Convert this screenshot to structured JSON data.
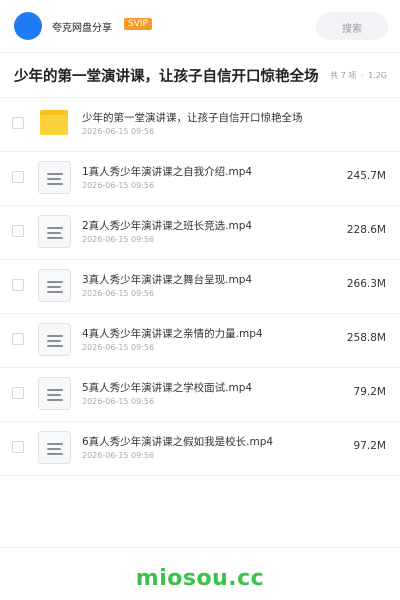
{
  "header": {
    "app_name": "夸克网盘分享",
    "badge": "SVIP",
    "search_placeholder": "搜索",
    "avatar_color": "#1f7cf5"
  },
  "share": {
    "title": "少年的第一堂演讲课，让孩子自信开口惊艳全场",
    "count": "共 7 项",
    "separator": "·",
    "total_size": "1.2G"
  },
  "files": [
    {
      "name": "少年的第一堂演讲课，让孩子自信开口惊艳全场",
      "date": "2026-06-15 09:56",
      "size": "",
      "icon": "folder-icon"
    },
    {
      "name": "1真人秀少年演讲课之自我介绍.mp4",
      "date": "2026-06-15 09:56",
      "size": "245.7M",
      "icon": "video-file-icon"
    },
    {
      "name": "2真人秀少年演讲课之班长竞选.mp4",
      "date": "2026-06-15 09:56",
      "size": "228.6M",
      "icon": "video-file-icon"
    },
    {
      "name": "3真人秀少年演讲课之舞台呈现.mp4",
      "date": "2026-06-15 09:56",
      "size": "266.3M",
      "icon": "video-file-icon"
    },
    {
      "name": "4真人秀少年演讲课之亲情的力量.mp4",
      "date": "2026-06-15 09:56",
      "size": "258.8M",
      "icon": "video-file-icon"
    },
    {
      "name": "5真人秀少年演讲课之学校面试.mp4",
      "date": "2026-06-15 09:56",
      "size": "79.2M",
      "icon": "video-file-icon"
    },
    {
      "name": "6真人秀少年演讲课之假如我是校长.mp4",
      "date": "2026-06-15 09:56",
      "size": "97.2M",
      "icon": "video-file-icon"
    }
  ],
  "watermark": "miosou.cc",
  "colors": {
    "accent": "#1f7cf5",
    "svip": "#f59a23",
    "folder": "#fcd23a",
    "watermark": "#3cc14b"
  }
}
